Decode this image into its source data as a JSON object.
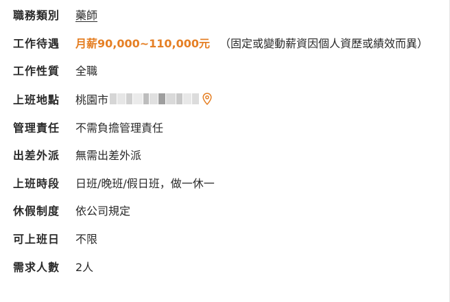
{
  "job_details": {
    "rows": [
      {
        "label": "職務類別",
        "value": "藥師"
      },
      {
        "label": "工作待遇",
        "value": "月薪90,000~110,000元",
        "note": "（固定或變動薪資因個人資歷或績效而異）"
      },
      {
        "label": "工作性質",
        "value": "全職"
      },
      {
        "label": "上班地點",
        "value": "桃園市"
      },
      {
        "label": "管理責任",
        "value": "不需負擔管理責任"
      },
      {
        "label": "出差外派",
        "value": "無需出差外派"
      },
      {
        "label": "上班時段",
        "value": "日班/晚班/假日班，做一休一"
      },
      {
        "label": "休假制度",
        "value": "依公司規定"
      },
      {
        "label": "可上班日",
        "value": "不限"
      },
      {
        "label": "需求人數",
        "value": "2人"
      }
    ]
  },
  "colors": {
    "salary": "#e57f24",
    "map_pin": "#e57f24",
    "text": "#292929"
  },
  "icons": {
    "location": "map-pin-icon"
  }
}
